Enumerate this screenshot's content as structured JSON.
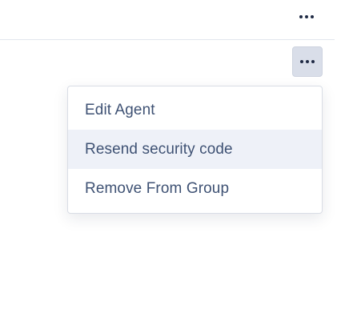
{
  "top_bar": {
    "more_button": {
      "icon": "more-horizontal-icon"
    }
  },
  "row": {
    "more_button": {
      "icon": "more-horizontal-icon",
      "state": "active"
    }
  },
  "context_menu": {
    "items": [
      {
        "label": "Edit Agent",
        "state": "default"
      },
      {
        "label": "Resend security code",
        "state": "hover"
      },
      {
        "label": "Remove From Group",
        "state": "default"
      }
    ],
    "hover_color": "#eef1f8",
    "text_color": "#3f5274"
  }
}
